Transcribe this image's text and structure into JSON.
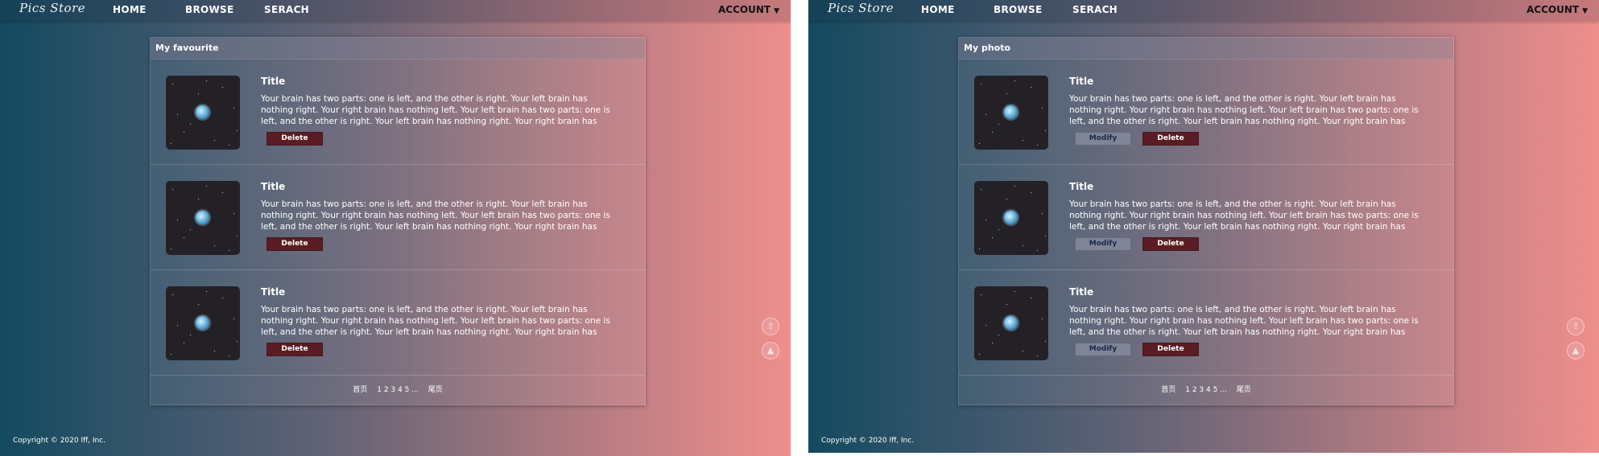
{
  "nav": {
    "logo": "Pics Store",
    "home": "HOME",
    "browse": "BROWSE",
    "search": "SERACH",
    "account": "ACCOUNT",
    "account_caret": "▼"
  },
  "left": {
    "section_title": "My favourite",
    "items": [
      {
        "title": "Title",
        "description": "Your brain has two parts: one is left, and the other is right. Your left brain has nothing right. Your right brain has nothing left. Your left brain has two parts: one is left, and the other is right. Your left brain has nothing right. Your right brain has nothing left. Your…",
        "delete": "Delete"
      },
      {
        "title": "Title",
        "description": "Your brain has two parts: one is left, and the other is right. Your left brain has nothing right. Your right brain has nothing left. Your left brain has two parts: one is left, and the other is right. Your left brain has nothing right. Your right brain has nothing left. Your…",
        "delete": "Delete"
      },
      {
        "title": "Title",
        "description": "Your brain has two parts: one is left, and the other is right. Your left brain has nothing right. Your right brain has nothing left. Your left brain has two parts: one is left, and the other is right. Your left brain has nothing right. Your right brain has nothing left. Your…",
        "delete": "Delete"
      }
    ]
  },
  "right": {
    "section_title": "My photo",
    "items": [
      {
        "title": "Title",
        "description": "Your brain has two parts: one is left, and the other is right. Your left brain has nothing right. Your right brain has nothing left. Your left brain has two parts: one is left, and the other is right. Your left brain has nothing right. Your right brain has nothing left. Your…",
        "modify": "Modify",
        "delete": "Delete"
      },
      {
        "title": "Title",
        "description": "Your brain has two parts: one is left, and the other is right. Your left brain has nothing right. Your right brain has nothing left. Your left brain has two parts: one is left, and the other is right. Your left brain has nothing right. Your right brain has nothing left. Your…",
        "modify": "Modify",
        "delete": "Delete"
      },
      {
        "title": "Title",
        "description": "Your brain has two parts: one is left, and the other is right. Your left brain has nothing right. Your right brain has nothing left. Your left brain has two parts: one is left, and the other is right. Your left brain has nothing right. Your right brain has nothing left. Your…",
        "modify": "Modify",
        "delete": "Delete"
      }
    ]
  },
  "pagination": {
    "first": "首页",
    "pages": "1 2 3 4 5 ...",
    "last": "尾页"
  },
  "side_icons": [
    "arrow-up-circle-icon",
    "triangle-up-icon"
  ],
  "footer": {
    "copyright": "Copyright © 2020 lff, Inc."
  },
  "colors": {
    "gradient_left": "#134a5f",
    "gradient_right": "#ee8f8c",
    "delete_button": "#5a1d23",
    "modify_button": "#7f8597"
  }
}
